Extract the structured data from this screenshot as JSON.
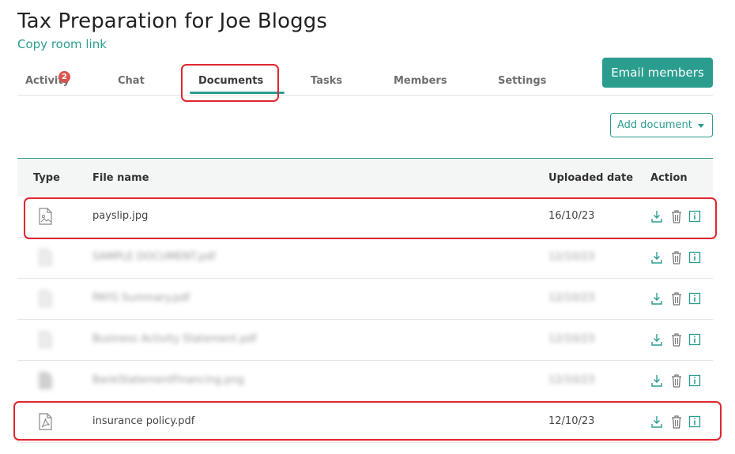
{
  "header": {
    "title": "Tax Preparation for Joe Bloggs",
    "room_link": "Copy room link",
    "email_button": "Email members"
  },
  "tabs": [
    {
      "label": "Activity",
      "badge": "2"
    },
    {
      "label": "Chat"
    },
    {
      "label": "Documents",
      "active": true
    },
    {
      "label": "Tasks"
    },
    {
      "label": "Members"
    },
    {
      "label": "Settings"
    }
  ],
  "add_document_label": "Add document",
  "table": {
    "columns": [
      "Type",
      "File name",
      "Uploaded date",
      "Action"
    ],
    "rows": [
      {
        "type_icon": "image-file-icon",
        "name": "payslip.jpg",
        "date": "16/10/23",
        "blurred": false
      },
      {
        "type_icon": "document-file-icon",
        "name": "SAMPLE DOCUMENT.pdf",
        "date": "12/10/23",
        "blurred": true
      },
      {
        "type_icon": "document-file-icon",
        "name": "PAYG Summary.pdf",
        "date": "12/10/23",
        "blurred": true
      },
      {
        "type_icon": "document-file-icon",
        "name": "Business Activity Statement.pdf",
        "date": "12/10/23",
        "blurred": true
      },
      {
        "type_icon": "image-file-icon",
        "name": "BankStatementFinancing.png",
        "date": "12/10/23",
        "blurred": true
      },
      {
        "type_icon": "pdf-file-icon",
        "name": "insurance policy.pdf",
        "date": "12/10/23",
        "blurred": false
      }
    ]
  },
  "colors": {
    "accent": "#2a9d8f",
    "highlight": "#e0262f",
    "badge": "#d9534f"
  }
}
